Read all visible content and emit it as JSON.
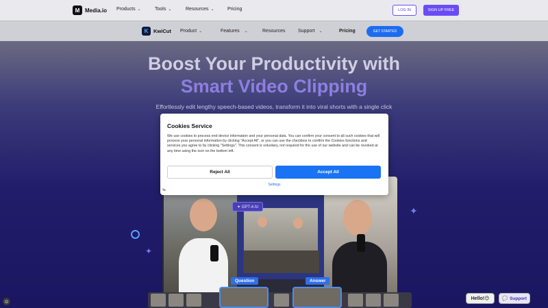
{
  "topnav": {
    "logo_text": "Media.io",
    "logo_glyph": "M",
    "items": [
      "Products",
      "Tools",
      "Resources",
      "Pricing"
    ],
    "login_label": "LOG IN",
    "signup_label": "SIGN UP FREE"
  },
  "subnav": {
    "product_name": "KwiCut",
    "product_glyph": "K",
    "items": [
      "Product",
      "Features",
      "Resources",
      "Support",
      "Pricing"
    ],
    "cta_label": "GET STARTED"
  },
  "hero": {
    "title_line1": "Boost Your Productivity with",
    "title_line2": "Smart Video Clipping",
    "subtitle": "Effortlessly edit lengthy speech-based videos, transform it into viral shorts with a single click",
    "gpt_badge": "✦ GPT-4 AI",
    "tag_question": "Question",
    "tag_answer": "Answer"
  },
  "cookie": {
    "title": "Cookies Service",
    "body": "We use cookies to process end device information and your personal data. You can confirm your consent to all such cookies that will process your personal information by clicking \"Accept All\", or you can use the checkbox to confirm the Cookies functions and services you agree to by clicking \"Settings\". This consent is voluntary, not required for the use of our website and can be revoked at any time using the icon on the bottom left.",
    "reject_label": "Reject All",
    "accept_label": "Accept All",
    "settings_label": "Settings",
    "footer_mark": "⇆"
  },
  "widgets": {
    "help_label": "Hello!😊",
    "support_label": "Support",
    "cookie_fab": "⊙"
  },
  "colors": {
    "accent": "#6a4cf5",
    "primary_blue": "#1a73f2",
    "hero_bg": "#1b1660"
  }
}
